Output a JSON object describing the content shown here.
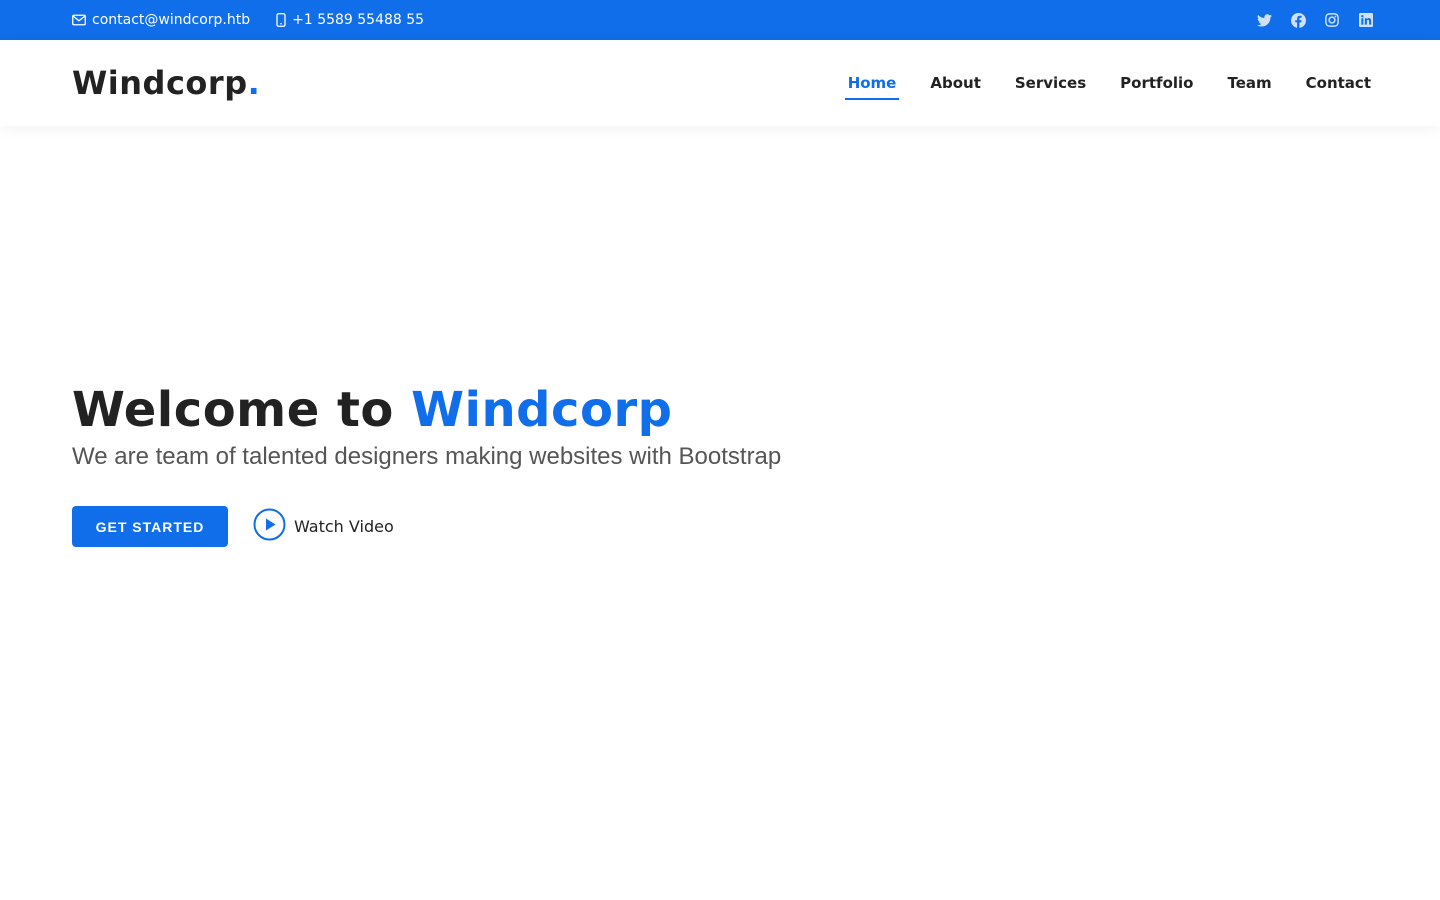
{
  "topbar": {
    "email": "contact@windcorp.htb",
    "phone": "+1 5589 55488 55",
    "email_icon": "envelope-icon",
    "phone_icon": "phone-icon",
    "social": [
      "twitter-icon",
      "facebook-icon",
      "instagram-icon",
      "linkedin-icon"
    ]
  },
  "header": {
    "logo_text": "Windcorp",
    "logo_dot": ".",
    "nav": [
      {
        "label": "Home",
        "active": true
      },
      {
        "label": "About"
      },
      {
        "label": "Services"
      },
      {
        "label": "Portfolio"
      },
      {
        "label": "Team"
      },
      {
        "label": "Contact"
      }
    ]
  },
  "hero": {
    "title_prefix": "Welcome to",
    "title_brand": "Windcorp",
    "subtitle": "We are team of talented designers making websites with Bootstrap",
    "cta_label": "GET STARTED",
    "video_label": "Watch Video",
    "video_icon": "play-circle-icon"
  },
  "colors": {
    "accent": "#106eea",
    "text": "#222222",
    "muted": "#555555",
    "background": "#ffffff"
  }
}
